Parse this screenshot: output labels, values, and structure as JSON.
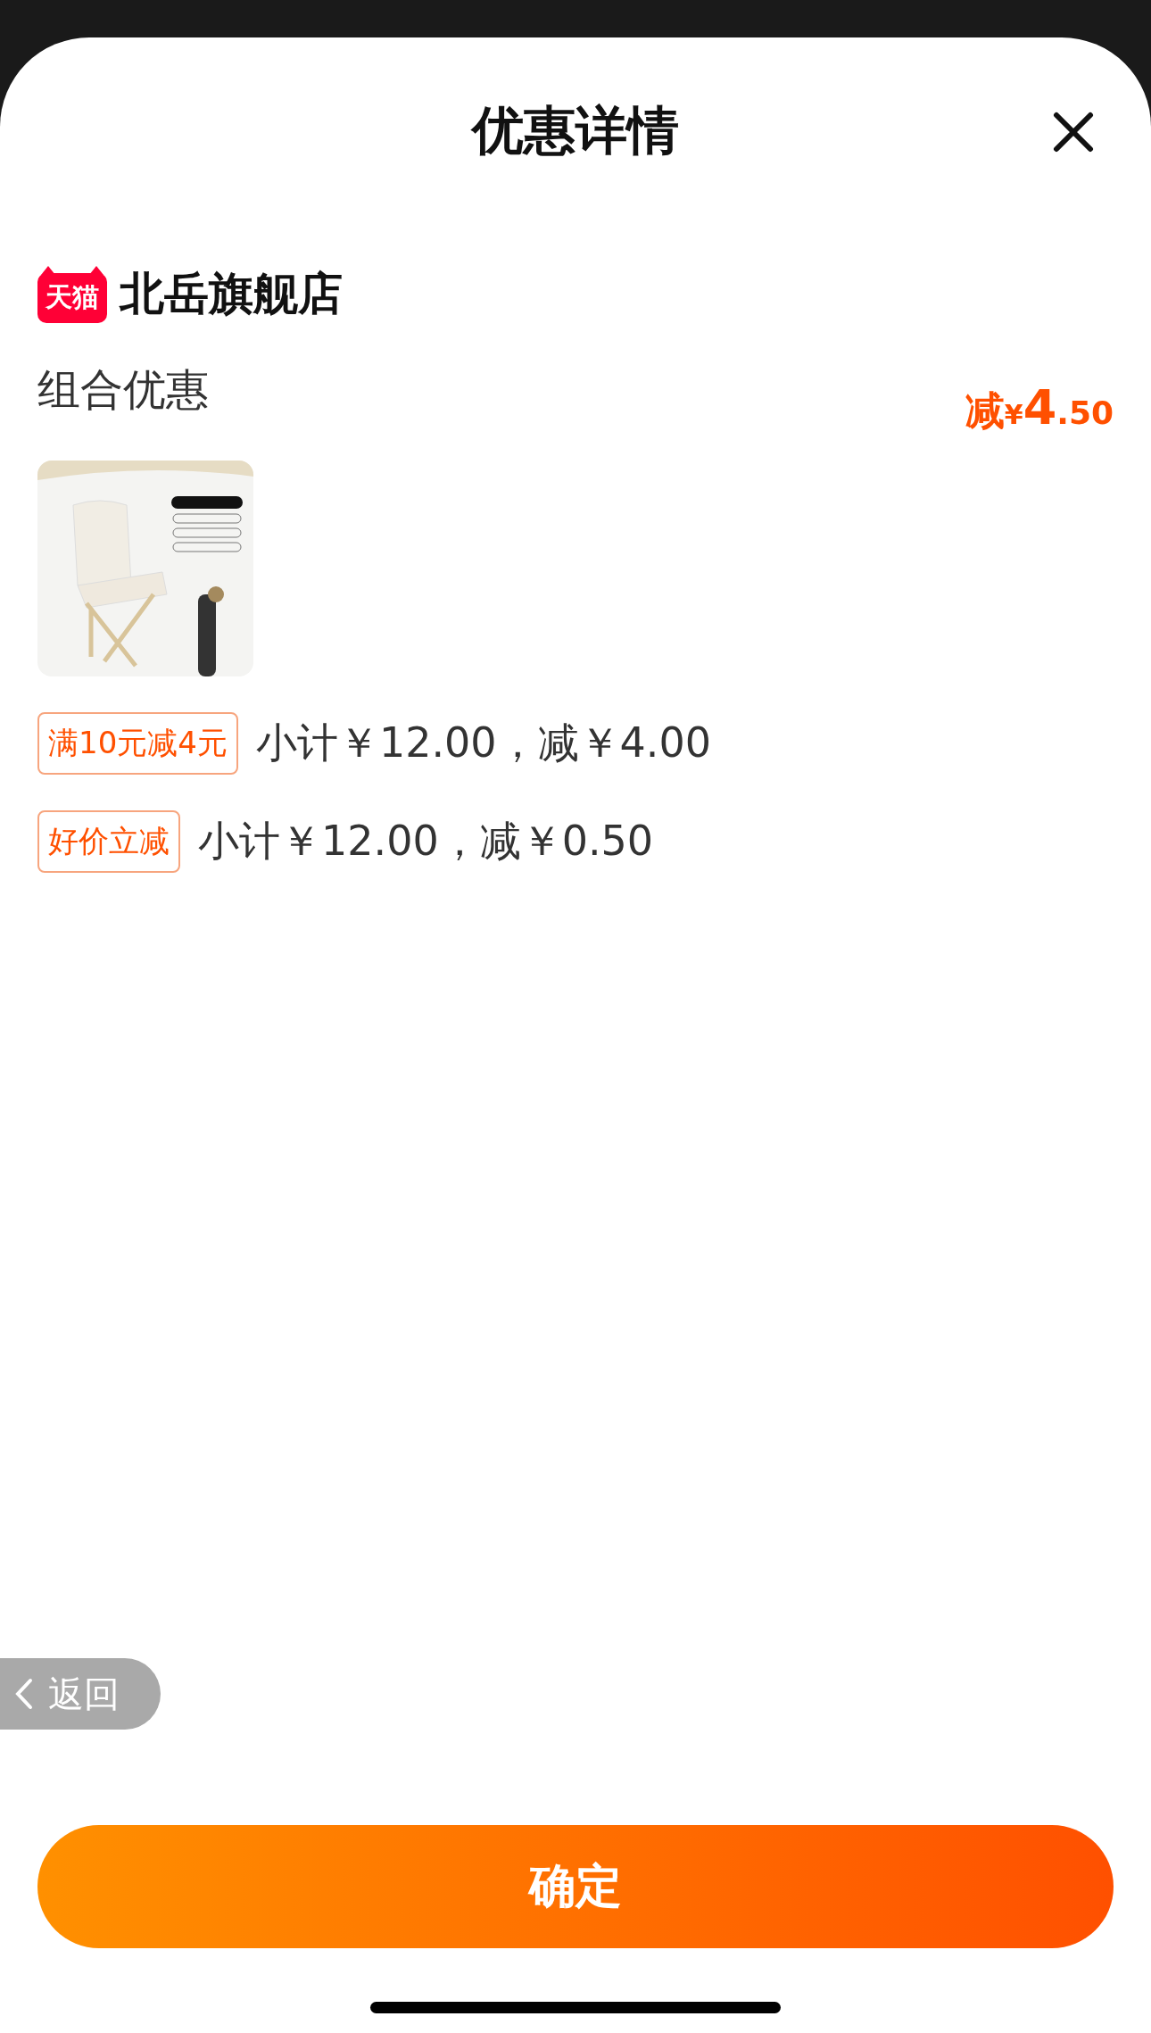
{
  "header": {
    "title": "优惠详情"
  },
  "store": {
    "badge": "天猫",
    "name": "北岳旗舰店"
  },
  "bundle": {
    "title": "组合优惠",
    "discount": {
      "prefix": "减",
      "currency": "¥",
      "integer": "4",
      "decimal": ".50"
    }
  },
  "promotions": [
    {
      "tag": "满10元减4元",
      "detail": "小计￥12.00，减￥4.00"
    },
    {
      "tag": "好价立减",
      "detail": "小计￥12.00，减￥0.50"
    }
  ],
  "back_button": {
    "label": "返回"
  },
  "confirm_button": {
    "label": "确定"
  }
}
